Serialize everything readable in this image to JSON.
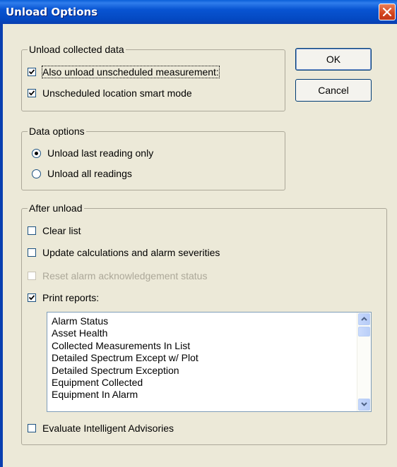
{
  "window": {
    "title": "Unload Options"
  },
  "buttons": {
    "ok": "OK",
    "cancel": "Cancel"
  },
  "unload_collected": {
    "legend": "Unload collected data",
    "also_unload_unscheduled": {
      "label": "Also unload unscheduled measurement:",
      "checked": true
    },
    "unscheduled_smart_mode": {
      "label": "Unscheduled location smart mode",
      "checked": true
    }
  },
  "data_options": {
    "legend": "Data options",
    "last_reading_only": {
      "label": "Unload last reading only",
      "selected": true
    },
    "all_readings": {
      "label": "Unload all readings",
      "selected": false
    }
  },
  "after_unload": {
    "legend": "After unload",
    "clear_list": {
      "label": "Clear list",
      "checked": false
    },
    "update_calculations": {
      "label": "Update calculations and alarm severities",
      "checked": false
    },
    "reset_alarm_ack": {
      "label": "Reset alarm acknowledgement status",
      "checked": false,
      "enabled": false
    },
    "print_reports": {
      "label": "Print reports:",
      "checked": true
    },
    "evaluate_advisories": {
      "label": "Evaluate Intelligent Advisories",
      "checked": false
    }
  },
  "reports_list": [
    "Alarm Status",
    "Asset Health",
    "Collected Measurements In List",
    "Detailed Spectrum Except w/ Plot",
    "Detailed Spectrum Exception",
    "Equipment Collected",
    "Equipment In Alarm"
  ],
  "icons": {
    "close": "close-x-icon",
    "check": "checkmark-icon",
    "scroll_up": "arrow-up-icon",
    "scroll_down": "arrow-down-icon"
  },
  "colors": {
    "titlebar": "#0854d2",
    "dialog_bg": "#ece9d8",
    "close_button": "#d4441c"
  }
}
